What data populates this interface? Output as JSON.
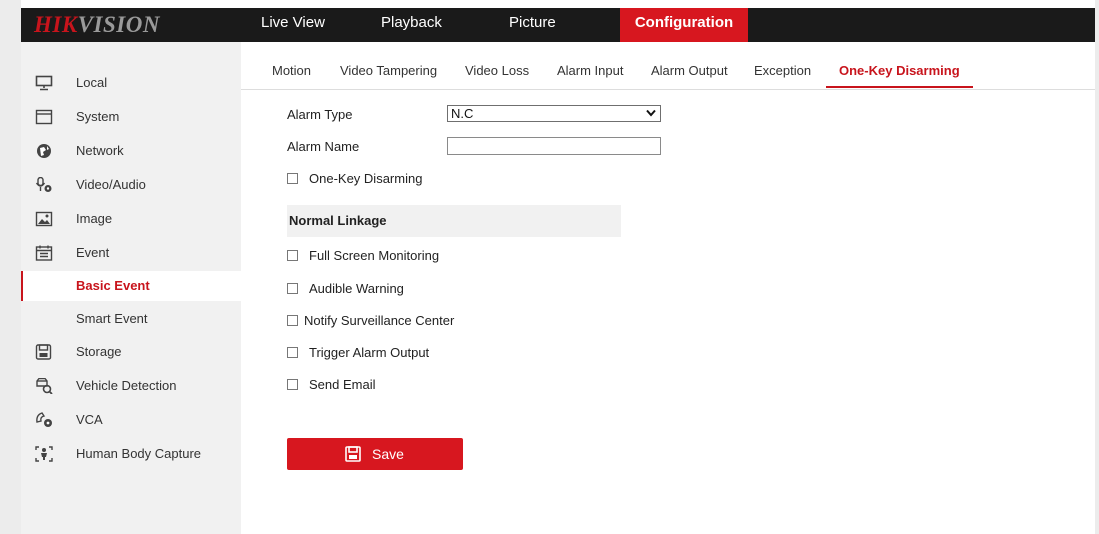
{
  "brand": {
    "part1": "HIK",
    "part2": "VISION"
  },
  "topnav": [
    {
      "label": "Live View"
    },
    {
      "label": "Playback"
    },
    {
      "label": "Picture"
    },
    {
      "label": "Configuration"
    }
  ],
  "sidebar": {
    "items": [
      {
        "label": "Local",
        "icon": "monitor-icon"
      },
      {
        "label": "System",
        "icon": "window-icon"
      },
      {
        "label": "Network",
        "icon": "globe-icon"
      },
      {
        "label": "Video/Audio",
        "icon": "microphone-icon"
      },
      {
        "label": "Image",
        "icon": "image-icon"
      },
      {
        "label": "Event",
        "icon": "calendar-icon"
      },
      {
        "label": "Basic Event"
      },
      {
        "label": "Smart Event"
      },
      {
        "label": "Storage",
        "icon": "storage-icon"
      },
      {
        "label": "Vehicle Detection",
        "icon": "vehicle-icon"
      },
      {
        "label": "VCA",
        "icon": "vca-icon"
      },
      {
        "label": "Human Body Capture",
        "icon": "human-body-icon"
      }
    ]
  },
  "tabs": [
    {
      "label": "Motion"
    },
    {
      "label": "Video Tampering"
    },
    {
      "label": "Video Loss"
    },
    {
      "label": "Alarm Input"
    },
    {
      "label": "Alarm Output"
    },
    {
      "label": "Exception"
    },
    {
      "label": "One-Key Disarming"
    }
  ],
  "form": {
    "alarm_type_label": "Alarm Type",
    "alarm_type_value": "N.C",
    "alarm_name_label": "Alarm Name",
    "alarm_name_value": "",
    "one_key_label": "One-Key Disarming",
    "section_title": "Normal Linkage",
    "linkage": [
      {
        "label": "Full Screen Monitoring"
      },
      {
        "label": "Audible Warning"
      },
      {
        "label": "Notify Surveillance Center"
      },
      {
        "label": "Trigger Alarm Output"
      },
      {
        "label": "Send Email"
      }
    ],
    "save_label": "Save"
  },
  "colors": {
    "accent": "#d7171f",
    "header": "#1a1a1a",
    "sidebar": "#f1f1f1"
  }
}
